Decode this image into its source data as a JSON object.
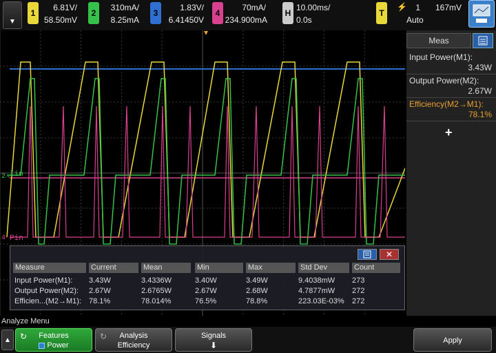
{
  "channels": [
    {
      "num": "1",
      "scale": "6.81V/",
      "offset": "58.50mV",
      "color": "#e8d83a"
    },
    {
      "num": "2",
      "scale": "310mA/",
      "offset": "8.25mA",
      "color": "#36c24a"
    },
    {
      "num": "3",
      "scale": "1.83V/",
      "offset": "6.41450V",
      "color": "#2f6fd2"
    },
    {
      "num": "4",
      "scale": "70mA/",
      "offset": "234.900mA",
      "color": "#d9408e"
    }
  ],
  "horizontal": {
    "label": "H",
    "timebase": "10.00ms/",
    "delay": "0.0s"
  },
  "trigger": {
    "label": "T",
    "source": "1",
    "level": "167mV",
    "mode": "Auto",
    "symbol": "⚡"
  },
  "side_panel": {
    "title": "Meas",
    "items": [
      {
        "label": "Input Power(M1):",
        "value": "3.43W"
      },
      {
        "label": "Output Power(M2):",
        "value": "2.67W"
      },
      {
        "label": "Efficiency(M2→M1):",
        "value": "78.1%"
      }
    ],
    "add": "+"
  },
  "trace_labels": {
    "iin": "Iin",
    "pin": "Pin"
  },
  "meas_table": {
    "headers": [
      "Measure",
      "Current",
      "Mean",
      "Min",
      "Max",
      "Std Dev",
      "Count"
    ],
    "rows": [
      [
        "Input Power(M1):",
        "3.43W",
        "3.4336W",
        "3.40W",
        "3.49W",
        "9.4038mW",
        "273"
      ],
      [
        "Output Power(M2):",
        "2.67W",
        "2.6765W",
        "2.67W",
        "2.68W",
        "4.7877mW",
        "272"
      ],
      [
        "Efficien...(M2→M1):",
        "78.1%",
        "78.014%",
        "76.5%",
        "78.8%",
        "223.03E-03%",
        "272"
      ]
    ],
    "close": "✕"
  },
  "menu_name": "Analyze Menu",
  "softkeys": {
    "features_top": "Features",
    "features_bottom": "Power",
    "analysis_top": "Analysis",
    "analysis_bottom": "Efficiency",
    "signals": "Signals",
    "apply": "Apply"
  }
}
